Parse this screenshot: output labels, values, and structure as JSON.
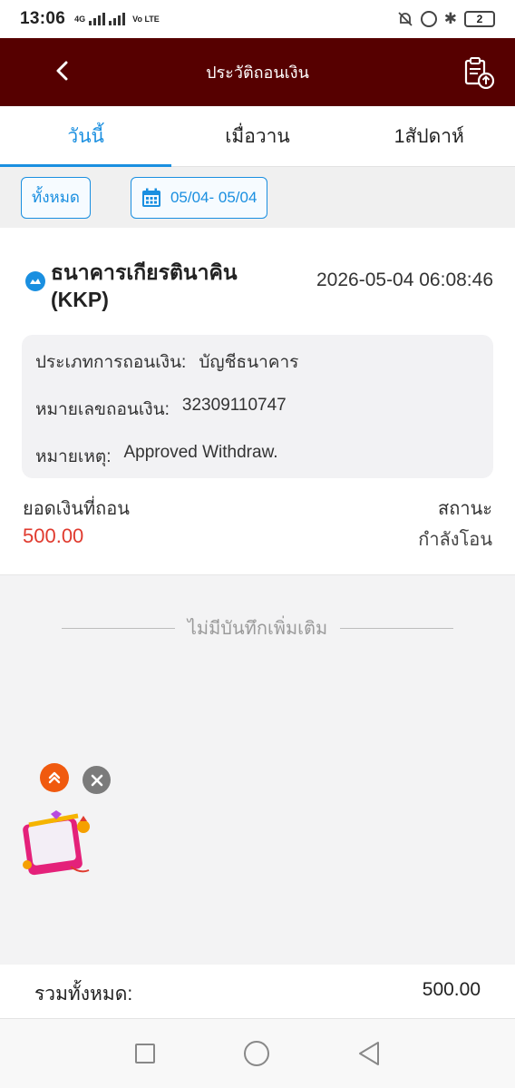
{
  "status_bar": {
    "time": "13:06",
    "network_label": "4G",
    "volte_label": "Vo LTE",
    "battery_label": "2"
  },
  "header": {
    "title": "ประวัติถอนเงิน"
  },
  "tabs": [
    {
      "label": "วันนี้",
      "active": true
    },
    {
      "label": "เมื่อวาน",
      "active": false
    },
    {
      "label": "1สัปดาห์",
      "active": false
    }
  ],
  "filters": {
    "all_label": "ทั้งหมด",
    "date_range": "05/04- 05/04"
  },
  "record": {
    "bank_name": "ธนาคารเกียรตินาคิน (KKP)",
    "timestamp": "2026-05-04 06:08:46",
    "details": [
      {
        "label": "ประเภทการถอนเงิน:",
        "value": "บัญชีธนาคาร"
      },
      {
        "label": "หมายเลขถอนเงิน:",
        "value": "32309110747"
      },
      {
        "label": "หมายเหตุ:",
        "value": "Approved Withdraw."
      }
    ],
    "amount_label": "ยอดเงินที่ถอน",
    "amount_value": "500.00",
    "status_label": "สถานะ",
    "status_value": "กำลังโอน"
  },
  "no_more_text": "ไม่มีบันทึกเพิ่มเติม",
  "total": {
    "label": "รวมทั้งหมด:",
    "value": "500.00"
  },
  "colors": {
    "header_bg": "#560000",
    "accent": "#1a8fe0",
    "amount": "#e03a2e"
  }
}
